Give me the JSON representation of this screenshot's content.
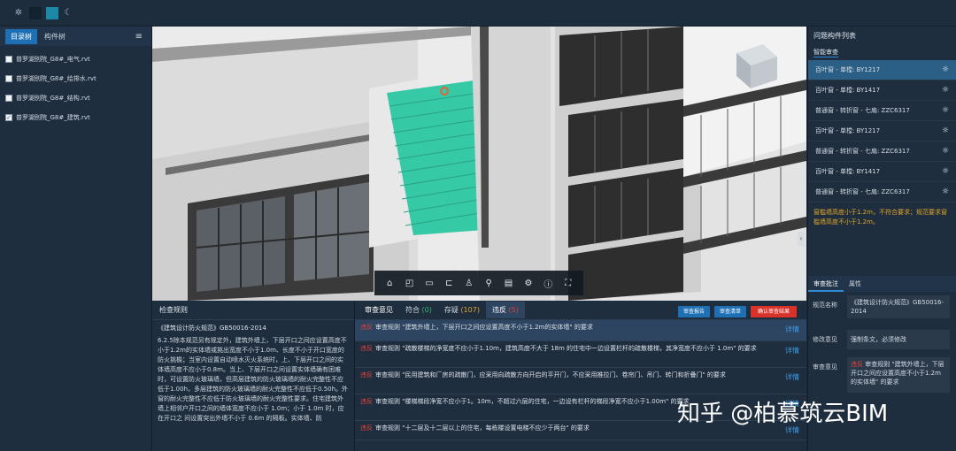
{
  "left_panel": {
    "tabs": [
      "目录树",
      "构件树"
    ],
    "files": [
      {
        "label": "普罗湖别院_G8#_电气.rvt",
        "checked": false
      },
      {
        "label": "普罗湖别院_G8#_给排水.rvt",
        "checked": false
      },
      {
        "label": "普罗湖别院_G8#_结构.rvt",
        "checked": false
      },
      {
        "label": "普罗湖别院_G8#_建筑.rvt",
        "checked": true
      }
    ]
  },
  "right_panel": {
    "title": "问题构件列表",
    "subtab": "智能审查",
    "issues": [
      "百叶窗 - 单樘: BY1217",
      "百叶窗 - 单樘: BY1417",
      "普通窗 - 转折窗 - 七扇: ZZC6317",
      "百叶窗 - 单樘: BY1217",
      "普通窗 - 转折窗 - 七扇: ZZC6317",
      "百叶窗 - 单樘: BY1417",
      "普通窗 - 转折窗 - 七扇: ZZC6317"
    ],
    "warning": "窗槛墙高度小于1.2m，不符合要求；规范要求窗槛墙高度不小于1.2m。",
    "bottom_tabs": [
      "审查批注",
      "属性"
    ],
    "props": {
      "spec_label": "规范名称",
      "spec_value": "《建筑设计防火规范》GB50016-2014",
      "opinion_label": "修改意见",
      "opinion_value": "强制条文，必须修改",
      "review_label": "审查意见",
      "review_tag": "违反",
      "review_value": "审查规则 \"建筑外墙上，下层开口之间应设置高度不小于1.2m的实体墙\" 的要求"
    }
  },
  "bottom_left": {
    "title": "检查规则",
    "standard": "《建筑设计防火规范》GB50016-2014",
    "body": "6.2.5除本规范另有规定外，建筑外墙上、下层开口之间应设置高度不小于1.2m的实体墙或挑出宽度不小于1.0m、长度不小于开口宽度的防火挑檐；当室内设置自动喷水灭火系统时，上、下层开口之间的实体墙高度不应小于0.8m。当上、下层开口之间设置实体墙确有困难时，可设置防火玻璃墙，但高层建筑的防火玻璃墙的耐火完整性不应低于1.00h，多层建筑的防火玻璃墙的耐火完整性不应低于0.50h。外窗的耐火完整性不应低于防火玻璃墙的耐火完整性要求。住宅建筑外墙上相邻户开口之间的墙体宽度不应小于 1.0m；小于 1.0m 时，应在开口之 间设置突出外墙不小于 0.6m 的隔板。实体墙、防"
  },
  "bottom_mid": {
    "tabs": [
      {
        "label": "审查意见",
        "count": ""
      },
      {
        "label": "符合",
        "count": "(0)"
      },
      {
        "label": "存疑",
        "count": "(107)"
      },
      {
        "label": "违反",
        "count": "(5)"
      }
    ],
    "buttons": [
      "审查报告",
      "审查清单",
      "确认审查结果"
    ],
    "tag": "违反",
    "detail": "详情",
    "rows": [
      "审查规则 \"建筑外墙上，下层开口之间应设置高度不小于1.2m的实体墙\" 的要求",
      "审查规则 \"疏散楼梯的净宽度不应小于1.10m，建筑高度不大于 18m 的住宅中一边设置栏杆的疏散楼梯，其净宽度不应小于 1.0m\" 的要求",
      "审查规则 \"民用建筑和厂房的疏散门，应采用向疏散方向开启的平开门，不应采用推拉门、卷帘门、吊门、转门和折叠门\" 的要求",
      "审查规则 \"楼梯梯段净宽不应小于1。10m，不超过六层的住宅，一边设有栏杆的梯段净宽不应小于1.00m\" 的要求",
      "审查规则 \"十二层及十二层以上的住宅，每栋楼设置电梯不应少于两台\" 的要求"
    ]
  },
  "watermark": "知乎 @柏慕筑云BIM",
  "colors": {
    "accent": "#1f6fb4",
    "violation": "#e0423a",
    "warning": "#e0a52a",
    "louver": "#35c9a6",
    "link": "#3b9de6"
  }
}
